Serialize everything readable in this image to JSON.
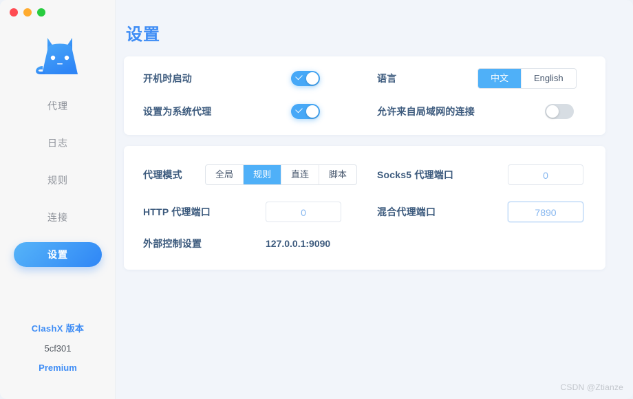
{
  "window": {
    "traffic_lights": [
      {
        "name": "close",
        "color": "#ff4b52"
      },
      {
        "name": "minimize",
        "color": "#ffab2e"
      },
      {
        "name": "zoom",
        "color": "#28cc3f"
      }
    ]
  },
  "sidebar": {
    "logo_name": "clashx-cat-logo",
    "items": [
      {
        "label": "代理",
        "active": false
      },
      {
        "label": "日志",
        "active": false
      },
      {
        "label": "规则",
        "active": false
      },
      {
        "label": "连接",
        "active": false
      },
      {
        "label": "设置",
        "active": true
      }
    ],
    "footer": {
      "version_title": "ClashX 版本",
      "version_hash": "5cf301",
      "edition": "Premium"
    }
  },
  "header": {
    "title": "设置"
  },
  "general_card": {
    "launch_at_login": {
      "label": "开机时启动",
      "toggle_on": true
    },
    "set_as_system_proxy": {
      "label": "设置为系统代理",
      "toggle_on": true
    },
    "language": {
      "label": "语言",
      "options": [
        "中文",
        "English"
      ],
      "selected": "中文"
    },
    "allow_lan": {
      "label": "允许来自局域网的连接",
      "toggle_on": false
    }
  },
  "proxy_card": {
    "proxy_mode": {
      "label": "代理模式",
      "options": [
        "全局",
        "规则",
        "直连",
        "脚本"
      ],
      "selected": "规则"
    },
    "socks5_port": {
      "label": "Socks5 代理端口",
      "value": "0"
    },
    "http_port": {
      "label": "HTTP 代理端口",
      "value": "0"
    },
    "mixed_port": {
      "label": "混合代理端口",
      "value": "7890",
      "highlighted": true
    },
    "external_controller": {
      "label": "外部控制设置",
      "value": "127.0.0.1:9090"
    }
  },
  "annotation": {
    "arrow_color": "#f5050b",
    "points_to": "mixed_port"
  },
  "watermark": {
    "text": "CSDN @Ztianze"
  }
}
